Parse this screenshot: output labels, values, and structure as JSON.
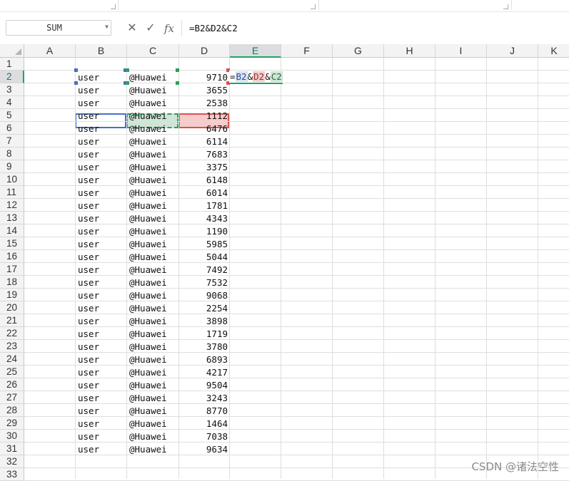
{
  "name_box": "SUM",
  "formula": "=B2&D2&C2",
  "columns": [
    "A",
    "B",
    "C",
    "D",
    "E",
    "F",
    "G",
    "H",
    "I",
    "J",
    "K"
  ],
  "active_column": "E",
  "active_row": 2,
  "icons": {
    "cancel": "close-icon",
    "confirm": "check-icon",
    "function": "fx-icon",
    "dropdown": "chevron-down-icon"
  },
  "edit": {
    "eq": "=",
    "r1": "B2",
    "amp1": "&",
    "r2": "D2",
    "amp2": "&",
    "r3": "C2"
  },
  "rows": [
    {
      "n": "1",
      "b": "",
      "c": "",
      "d": ""
    },
    {
      "n": "2",
      "b": "user",
      "c": "@Huawei",
      "d": "9710"
    },
    {
      "n": "3",
      "b": "user",
      "c": "@Huawei",
      "d": "3655"
    },
    {
      "n": "4",
      "b": "user",
      "c": "@Huawei",
      "d": "2538"
    },
    {
      "n": "5",
      "b": "user",
      "c": "@Huawei",
      "d": "1112"
    },
    {
      "n": "6",
      "b": "user",
      "c": "@Huawei",
      "d": "6476"
    },
    {
      "n": "7",
      "b": "user",
      "c": "@Huawei",
      "d": "6114"
    },
    {
      "n": "8",
      "b": "user",
      "c": "@Huawei",
      "d": "7683"
    },
    {
      "n": "9",
      "b": "user",
      "c": "@Huawei",
      "d": "3375"
    },
    {
      "n": "10",
      "b": "user",
      "c": "@Huawei",
      "d": "6148"
    },
    {
      "n": "11",
      "b": "user",
      "c": "@Huawei",
      "d": "6014"
    },
    {
      "n": "12",
      "b": "user",
      "c": "@Huawei",
      "d": "1781"
    },
    {
      "n": "13",
      "b": "user",
      "c": "@Huawei",
      "d": "4343"
    },
    {
      "n": "14",
      "b": "user",
      "c": "@Huawei",
      "d": "1190"
    },
    {
      "n": "15",
      "b": "user",
      "c": "@Huawei",
      "d": "5985"
    },
    {
      "n": "16",
      "b": "user",
      "c": "@Huawei",
      "d": "5044"
    },
    {
      "n": "17",
      "b": "user",
      "c": "@Huawei",
      "d": "7492"
    },
    {
      "n": "18",
      "b": "user",
      "c": "@Huawei",
      "d": "7532"
    },
    {
      "n": "19",
      "b": "user",
      "c": "@Huawei",
      "d": "9068"
    },
    {
      "n": "20",
      "b": "user",
      "c": "@Huawei",
      "d": "2254"
    },
    {
      "n": "21",
      "b": "user",
      "c": "@Huawei",
      "d": "3898"
    },
    {
      "n": "22",
      "b": "user",
      "c": "@Huawei",
      "d": "1719"
    },
    {
      "n": "23",
      "b": "user",
      "c": "@Huawei",
      "d": "3780"
    },
    {
      "n": "24",
      "b": "user",
      "c": "@Huawei",
      "d": "6893"
    },
    {
      "n": "25",
      "b": "user",
      "c": "@Huawei",
      "d": "4217"
    },
    {
      "n": "26",
      "b": "user",
      "c": "@Huawei",
      "d": "9504"
    },
    {
      "n": "27",
      "b": "user",
      "c": "@Huawei",
      "d": "3243"
    },
    {
      "n": "28",
      "b": "user",
      "c": "@Huawei",
      "d": "8770"
    },
    {
      "n": "29",
      "b": "user",
      "c": "@Huawei",
      "d": "1464"
    },
    {
      "n": "30",
      "b": "user",
      "c": "@Huawei",
      "d": "7038"
    },
    {
      "n": "31",
      "b": "user",
      "c": "@Huawei",
      "d": "9634"
    },
    {
      "n": "32",
      "b": "",
      "c": "",
      "d": ""
    },
    {
      "n": "33",
      "b": "",
      "c": "",
      "d": ""
    }
  ],
  "watermark": "CSDN @诸法空性"
}
